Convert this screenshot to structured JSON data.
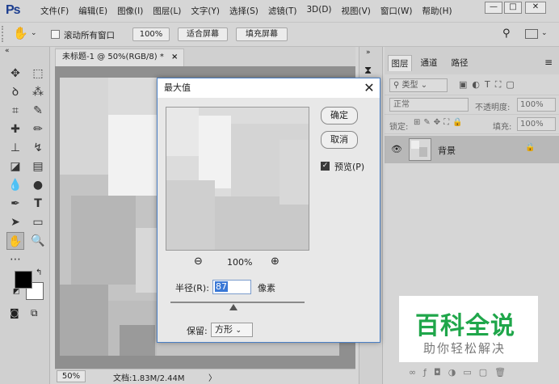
{
  "app": {
    "logo": "Ps"
  },
  "menu": [
    "文件(F)",
    "编辑(E)",
    "图像(I)",
    "图层(L)",
    "文字(Y)",
    "选择(S)",
    "滤镜(T)",
    "3D(D)",
    "视图(V)",
    "窗口(W)",
    "帮助(H)"
  ],
  "window_controls": {
    "minimize": "—",
    "restore": "□",
    "close": "✕"
  },
  "options": {
    "scroll_all_label": "滚动所有窗口",
    "zoom_100": "100%",
    "fit_screen": "适合屏幕",
    "fill_screen": "填充屏幕"
  },
  "document": {
    "tab_title": "未标题-1 @ 50%(RGB/8) *",
    "tab_close": "×",
    "status_zoom": "50%",
    "status_doc": "文档:1.83M/2.44M",
    "status_arrow": "〉"
  },
  "dialog": {
    "title": "最大值",
    "close": "✕",
    "ok": "确定",
    "cancel": "取消",
    "preview_label": "预览(P)",
    "preview_checked": true,
    "zoom_out": "⊖",
    "zoom_level": "100%",
    "zoom_in": "⊕",
    "radius_label": "半径(R):",
    "radius_value": "87",
    "radius_unit": "像素",
    "keep_label": "保留:",
    "keep_value": "方形"
  },
  "layers_panel": {
    "tabs": [
      "图层",
      "通道",
      "路径"
    ],
    "kind_filter": "类型",
    "blend_mode": "正常",
    "opacity_label": "不透明度:",
    "opacity_value": "100%",
    "lock_label": "锁定:",
    "fill_label": "填充:",
    "fill_value": "100%",
    "layer_name": "背景"
  },
  "watermark": {
    "title": "百科全说",
    "subtitle": "助你轻松解决",
    "color": "#1fa64a"
  },
  "colors": {
    "foreground": "#000000",
    "background": "#ffffff",
    "dialog_border": "#4a7fc4"
  }
}
